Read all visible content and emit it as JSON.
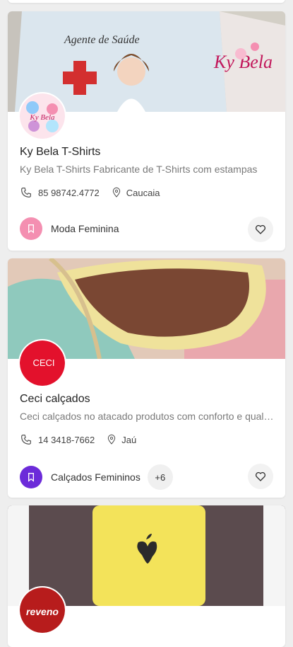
{
  "listings": [
    {
      "title": "Ky Bela T-Shirts",
      "description": "Ky Bela T-Shirts Fabricante de T-Shirts  com estampas",
      "phone": "85 98742.4772",
      "city": "Caucaia",
      "category": "Moda Feminina",
      "category_color": "#f48fb1",
      "cover_text": "Agente de Saúde",
      "cover_brand": "Ky Bela",
      "logo_text": "Ky Bela"
    },
    {
      "title": "Ceci calçados",
      "description": "Ceci calçados no atacado produtos com conforto e qualidade",
      "phone": "14 3418-7662",
      "city": "Jaú",
      "category": "Calçados Femininos",
      "category_color": "#6c2bd9",
      "more_count": "+6",
      "logo_text": "CECI",
      "logo_color": "#e3112c"
    },
    {
      "logo_text": "reveno",
      "logo_color": "#b71c1c"
    }
  ],
  "icons": {
    "phone": "phone-icon",
    "location": "location-pin-icon",
    "category": "bookmark-icon",
    "favorite": "heart-outline-icon"
  }
}
